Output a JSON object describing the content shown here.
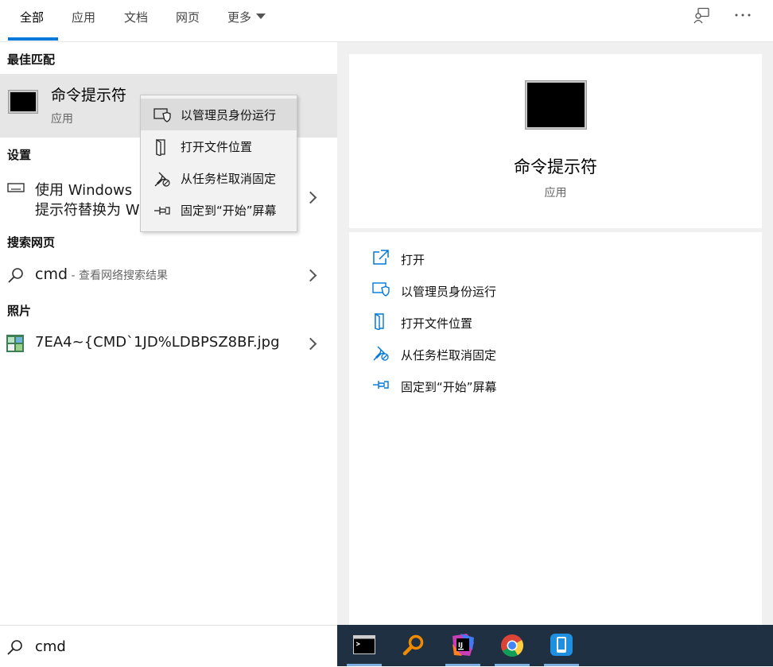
{
  "tabs": [
    {
      "label": "全部"
    },
    {
      "label": "应用"
    },
    {
      "label": "文档"
    },
    {
      "label": "网页"
    },
    {
      "label": "更多"
    }
  ],
  "sections": {
    "best_match": "最佳匹配",
    "settings": "设置",
    "web_search": "搜索网页",
    "photos": "照片"
  },
  "best_match": {
    "title": "命令提示符",
    "subtitle": "应用"
  },
  "settings_item": {
    "line1": "使用 Windows",
    "line2": "提示符替换为 W"
  },
  "web_item": {
    "query": "cmd",
    "suffix": " - 查看网络搜索结果"
  },
  "photo_item": {
    "filename": "7EA4~{CMD`1JD%LDBPSZ8BF.jpg"
  },
  "context_menu": [
    {
      "label": "以管理员身份运行",
      "icon": "shield-icon"
    },
    {
      "label": "打开文件位置",
      "icon": "folder-location-icon"
    },
    {
      "label": "从任务栏取消固定",
      "icon": "unpin-icon"
    },
    {
      "label": "固定到“开始”屏幕",
      "icon": "pin-icon"
    }
  ],
  "preview": {
    "title": "命令提示符",
    "subtitle": "应用"
  },
  "actions": [
    {
      "label": "打开",
      "icon": "open-icon"
    },
    {
      "label": "以管理员身份运行",
      "icon": "shield-icon"
    },
    {
      "label": "打开文件位置",
      "icon": "folder-location-icon"
    },
    {
      "label": "从任务栏取消固定",
      "icon": "unpin-icon"
    },
    {
      "label": "固定到“开始”屏幕",
      "icon": "pin-icon"
    }
  ],
  "search": {
    "value": "cmd"
  },
  "taskbar": [
    {
      "icon": "cmd-app-icon"
    },
    {
      "icon": "search-magnifier-app-icon"
    },
    {
      "icon": "intellij-idea-icon"
    },
    {
      "icon": "chrome-icon"
    },
    {
      "icon": "phone-app-icon"
    }
  ],
  "colors": {
    "accent": "#0078d7",
    "taskbar": "#1f3042",
    "highlight": "#e6e6e6"
  }
}
